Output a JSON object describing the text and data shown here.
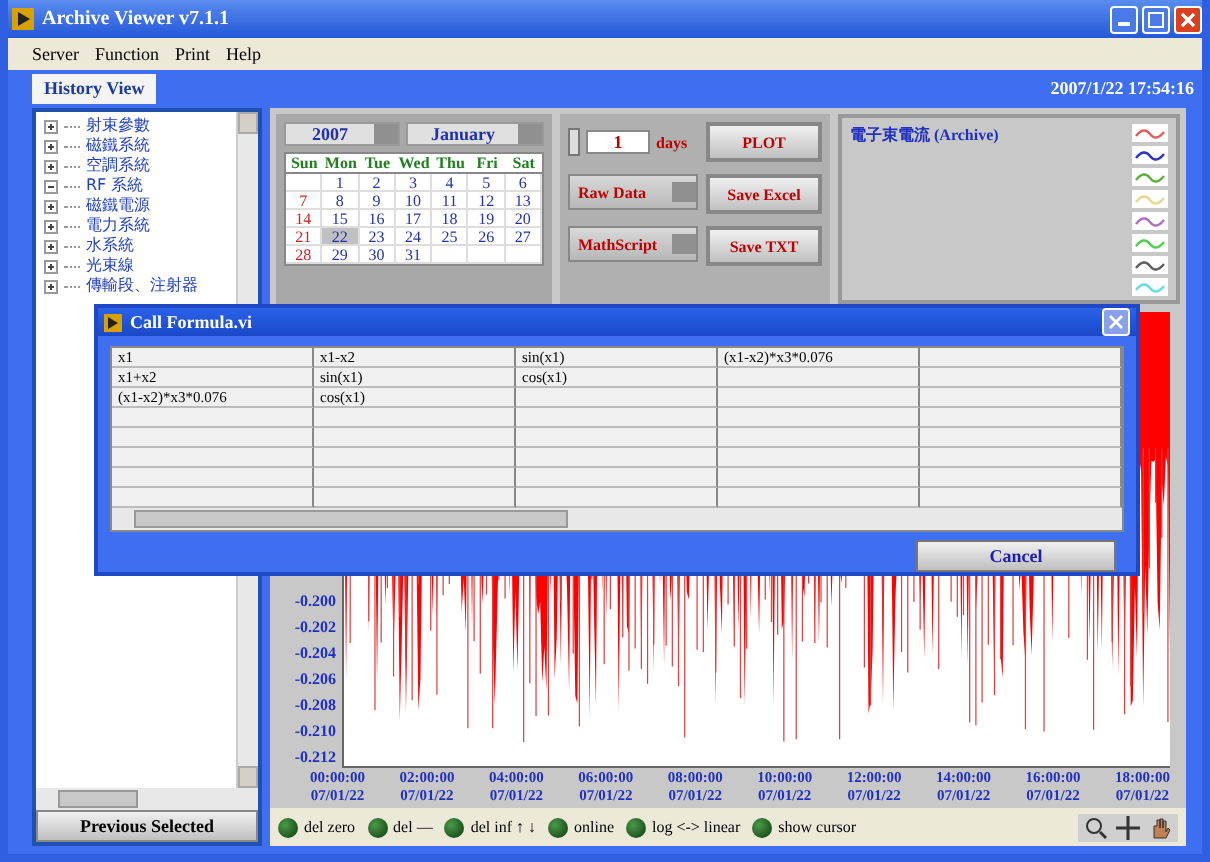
{
  "window": {
    "title": "Archive Viewer v7.1.1"
  },
  "menu": [
    "Server",
    "Function",
    "Print",
    "Help"
  ],
  "tabs": [
    {
      "label": "History View",
      "selected": true
    }
  ],
  "timestamp": "2007/1/22 17:54:16",
  "tree": [
    {
      "label": "射束參數",
      "expanded": false
    },
    {
      "label": "磁鐵系統",
      "expanded": false
    },
    {
      "label": "空調系統",
      "expanded": false
    },
    {
      "label": "RF 系統",
      "expanded": true
    },
    {
      "label": "磁鐵電源",
      "expanded": false
    },
    {
      "label": "電力系統",
      "expanded": false
    },
    {
      "label": "水系統",
      "expanded": false
    },
    {
      "label": "光束線",
      "expanded": false
    },
    {
      "label": "傳輸段、注射器",
      "expanded": false
    }
  ],
  "previous_button": "Previous Selected",
  "calendar": {
    "year": "2007",
    "month": "January",
    "weekdays": [
      "Sun",
      "Mon",
      "Tue",
      "Wed",
      "Thu",
      "Fri",
      "Sat"
    ],
    "weeks": [
      [
        {
          "day": "1",
          "selected": false
        },
        {
          "day": "2",
          "selected": false
        },
        {
          "day": "3",
          "selected": false
        },
        {
          "day": "4",
          "selected": false
        },
        {
          "day": "5",
          "selected": false
        },
        {
          "day": "6",
          "selected": false
        }
      ],
      [
        {
          "day": "7",
          "selected": false
        },
        {
          "day": "8",
          "selected": false
        },
        {
          "day": "9",
          "selected": false
        },
        {
          "day": "10",
          "selected": false
        },
        {
          "day": "11",
          "selected": false
        },
        {
          "day": "12",
          "selected": false
        },
        {
          "day": "13",
          "selected": false
        }
      ],
      [
        {
          "day": "14",
          "selected": false
        },
        {
          "day": "15",
          "selected": false
        },
        {
          "day": "16",
          "selected": false
        },
        {
          "day": "17",
          "selected": false
        },
        {
          "day": "18",
          "selected": false
        },
        {
          "day": "19",
          "selected": false
        },
        {
          "day": "20",
          "selected": false
        }
      ],
      [
        {
          "day": "21",
          "selected": false
        },
        {
          "day": "22",
          "selected": true
        },
        {
          "day": "23",
          "selected": false
        },
        {
          "day": "24",
          "selected": false
        },
        {
          "day": "25",
          "selected": false
        },
        {
          "day": "26",
          "selected": false
        },
        {
          "day": "27",
          "selected": false
        }
      ],
      [
        {
          "day": "28",
          "selected": false
        },
        {
          "day": "29",
          "selected": false
        },
        {
          "day": "30",
          "selected": false
        },
        {
          "day": "31",
          "selected": false
        }
      ]
    ]
  },
  "range": {
    "value": "1",
    "unit": "days"
  },
  "data_mode": "Raw Data",
  "math_mode": "MathScript",
  "buttons": [
    "PLOT",
    "Save Excel",
    "Save TXT"
  ],
  "legend": {
    "title": "電子束電流 (Archive)",
    "swatches": [
      {
        "color": "#e06060"
      },
      {
        "color": "#3030d0"
      },
      {
        "color": "#60b040"
      },
      {
        "color": "#e8d890"
      },
      {
        "color": "#b070c0"
      },
      {
        "color": "#50d050"
      },
      {
        "color": "#606060"
      },
      {
        "color": "#60e0e0"
      }
    ]
  },
  "chart": {
    "yticks": [
      "-0.200",
      "-0.202",
      "-0.204",
      "-0.206",
      "-0.208",
      "-0.210",
      "-0.212"
    ],
    "xticks": [
      {
        "time": "00:00:00",
        "date": "07/01/22"
      },
      {
        "time": "02:00:00",
        "date": "07/01/22"
      },
      {
        "time": "04:00:00",
        "date": "07/01/22"
      },
      {
        "time": "06:00:00",
        "date": "07/01/22"
      },
      {
        "time": "08:00:00",
        "date": "07/01/22"
      },
      {
        "time": "10:00:00",
        "date": "07/01/22"
      },
      {
        "time": "12:00:00",
        "date": "07/01/22"
      },
      {
        "time": "14:00:00",
        "date": "07/01/22"
      },
      {
        "time": "16:00:00",
        "date": "07/01/22"
      },
      {
        "time": "18:00:00",
        "date": "07/01/22"
      }
    ]
  },
  "toggles": [
    {
      "label": "del zero",
      "on": false
    },
    {
      "label": "del —",
      "on": false
    },
    {
      "label": "del inf ↑ ↓",
      "on": false
    },
    {
      "label": "online",
      "on": false
    },
    {
      "label": "log <-> linear",
      "on": false
    },
    {
      "label": "show cursor",
      "on": false
    }
  ],
  "dialog": {
    "title": "Call Formula.vi",
    "rows": [
      [
        "x1",
        "x1-x2",
        "sin(x1)",
        "(x1-x2)*x3*0.076"
      ],
      [
        "x1+x2",
        "sin(x1)",
        "cos(x1)"
      ],
      [
        "(x1-x2)*x3*0.076",
        "cos(x1)"
      ]
    ],
    "cancel": "Cancel"
  }
}
